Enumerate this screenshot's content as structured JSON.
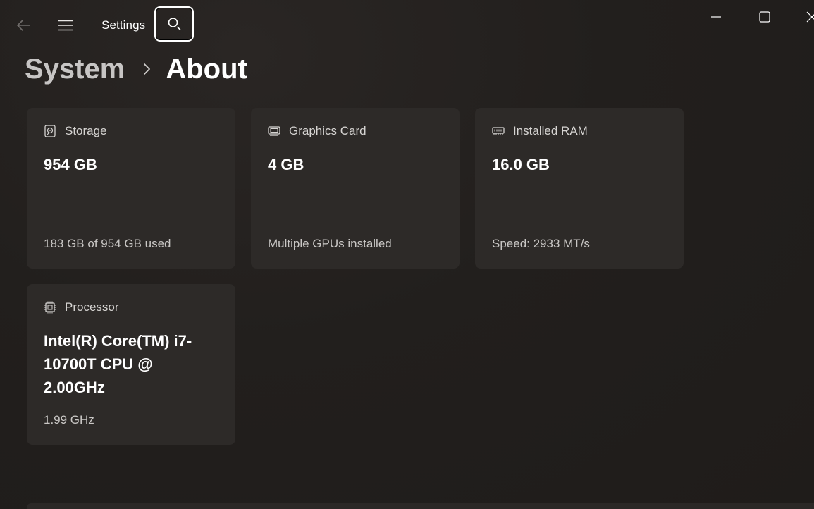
{
  "window": {
    "app_title": "Settings"
  },
  "breadcrumb": {
    "parent": "System",
    "current": "About"
  },
  "cards": {
    "storage": {
      "label": "Storage",
      "value": "954 GB",
      "sub": "183 GB of 954 GB used",
      "icon": "storage-icon"
    },
    "graphics": {
      "label": "Graphics Card",
      "value": "4 GB",
      "sub": "Multiple GPUs installed",
      "icon": "graphics-card-icon"
    },
    "ram": {
      "label": "Installed RAM",
      "value": "16.0 GB",
      "sub": "Speed: 2933 MT/s",
      "icon": "ram-icon"
    },
    "processor": {
      "label": "Processor",
      "value": "Intel(R) Core(TM) i7-10700T CPU @ 2.00GHz",
      "sub": "1.99 GHz",
      "icon": "processor-icon"
    }
  },
  "colors": {
    "background": "#211f1d",
    "card": "#2d2a28",
    "text_primary": "#ffffff",
    "text_secondary": "#c9c7c5"
  }
}
